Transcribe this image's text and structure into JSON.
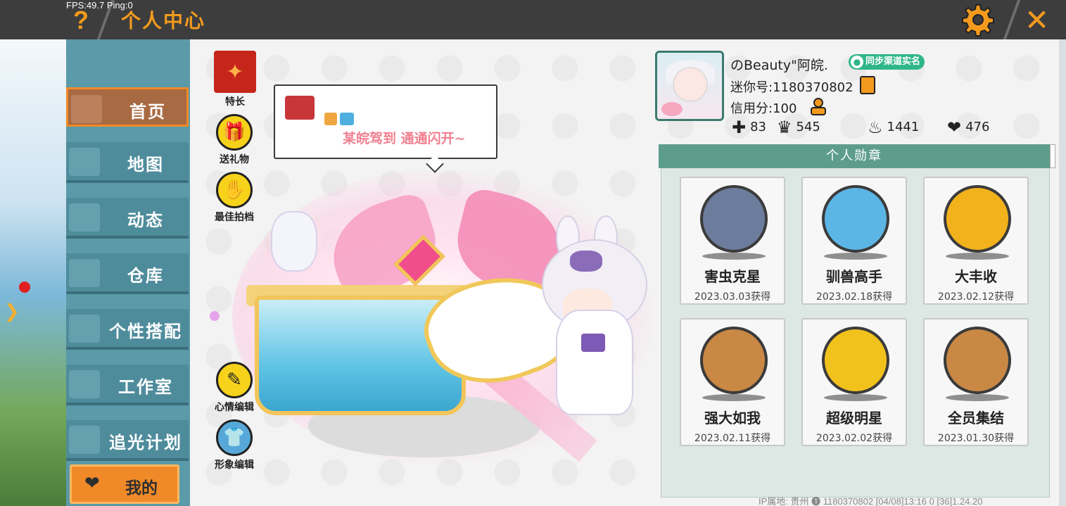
{
  "hud": {
    "fps_text": "FPS:49.7",
    "ping_text": "Ping:0"
  },
  "header": {
    "help_glyph": "?",
    "title": "个人中心",
    "settings_icon": "gear-icon",
    "close_glyph": "✕",
    "accent_color": "#f39a1e"
  },
  "nav": {
    "items": [
      {
        "label": "首页",
        "icon": "house-icon",
        "active": true
      },
      {
        "label": "地图",
        "icon": "map-icon"
      },
      {
        "label": "动态",
        "icon": "bell-icon"
      },
      {
        "label": "仓库",
        "icon": "warehouse-icon"
      },
      {
        "label": "个性搭配",
        "icon": "outfit-icon"
      },
      {
        "label": "工作室",
        "icon": "studio-icon"
      },
      {
        "label": "追光计划",
        "icon": "plan-icon"
      }
    ],
    "mine": {
      "label": "我的",
      "icon": "heart-icon"
    }
  },
  "actions": [
    {
      "label": "特长",
      "icon": "specialty-icon"
    },
    {
      "label": "送礼物",
      "icon": "gift-icon"
    },
    {
      "label": "最佳拍档",
      "icon": "handshake-icon"
    },
    {
      "label": "心情编辑",
      "icon": "edit-icon"
    },
    {
      "label": "形象编辑",
      "icon": "outfit-edit-icon"
    }
  ],
  "bubble": {
    "message": "某皖驾到 通通闪开~"
  },
  "profile": {
    "name": "のBeauty\"阿皖.",
    "sync_label": "同步渠道实名",
    "mini_id": "迷你号:1180370802",
    "credit": "信用分:100",
    "stats": [
      {
        "icon": "plus-icon",
        "value": "83"
      },
      {
        "icon": "fans-icon",
        "value": "545"
      },
      {
        "icon": "flame-icon",
        "value": "1441"
      },
      {
        "icon": "hearts-icon",
        "value": "476"
      }
    ]
  },
  "medals": {
    "header": "个人勋章",
    "items": [
      {
        "name": "害虫克星",
        "date": "2023.03.03获得",
        "color": "#6c7c9c"
      },
      {
        "name": "驯兽高手",
        "date": "2023.02.18获得",
        "color": "#5bb6e6"
      },
      {
        "name": "大丰收",
        "date": "2023.02.12获得",
        "color": "#f2b21c"
      },
      {
        "name": "强大如我",
        "date": "2023.02.11获得",
        "color": "#c98844"
      },
      {
        "name": "超级明星",
        "date": "2023.02.02获得",
        "color": "#f2c21c"
      },
      {
        "name": "全员集结",
        "date": "2023.01.30获得",
        "color": "#c98844"
      }
    ]
  },
  "footer": {
    "text": "IP属地: 贵州 ❶   1180370802   [04/08]13:16 0   [36]1.24.20"
  }
}
